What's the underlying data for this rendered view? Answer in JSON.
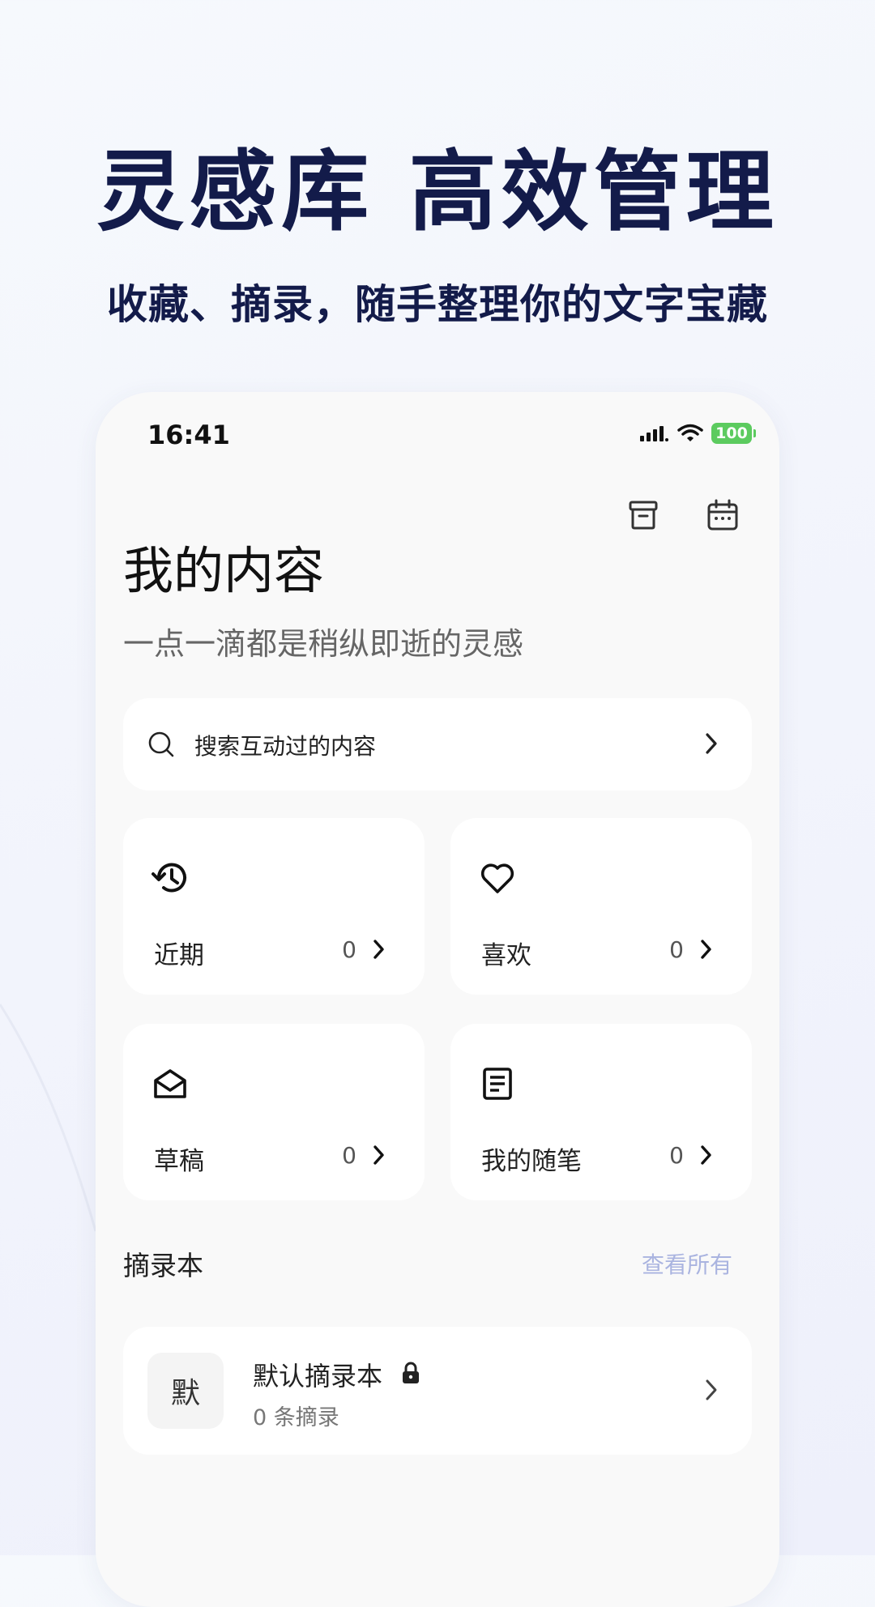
{
  "promo": {
    "headline": "灵感库 高效管理",
    "subheadline": "收藏、摘录，随手整理你的文字宝藏"
  },
  "status_bar": {
    "time": "16:41",
    "battery": "100"
  },
  "header": {
    "title": "我的内容",
    "subtitle": "一点一滴都是稍纵即逝的灵感",
    "icons": [
      "archive-icon",
      "calendar-icon"
    ]
  },
  "search": {
    "placeholder": "搜索互动过的内容"
  },
  "cards": [
    {
      "label": "近期",
      "count": "0",
      "icon": "history-icon"
    },
    {
      "label": "喜欢",
      "count": "0",
      "icon": "heart-icon"
    },
    {
      "label": "草稿",
      "count": "0",
      "icon": "draft-envelope-icon"
    },
    {
      "label": "我的随笔",
      "count": "0",
      "icon": "note-icon"
    }
  ],
  "excerpts": {
    "section_title": "摘录本",
    "view_all": "查看所有",
    "notebooks": [
      {
        "thumb": "默",
        "name": "默认摘录本",
        "count": "0 条摘录",
        "locked": true
      }
    ]
  },
  "colors": {
    "headline": "#131b4a",
    "view_all": "#aab4e0",
    "battery": "#5ccb5f"
  }
}
